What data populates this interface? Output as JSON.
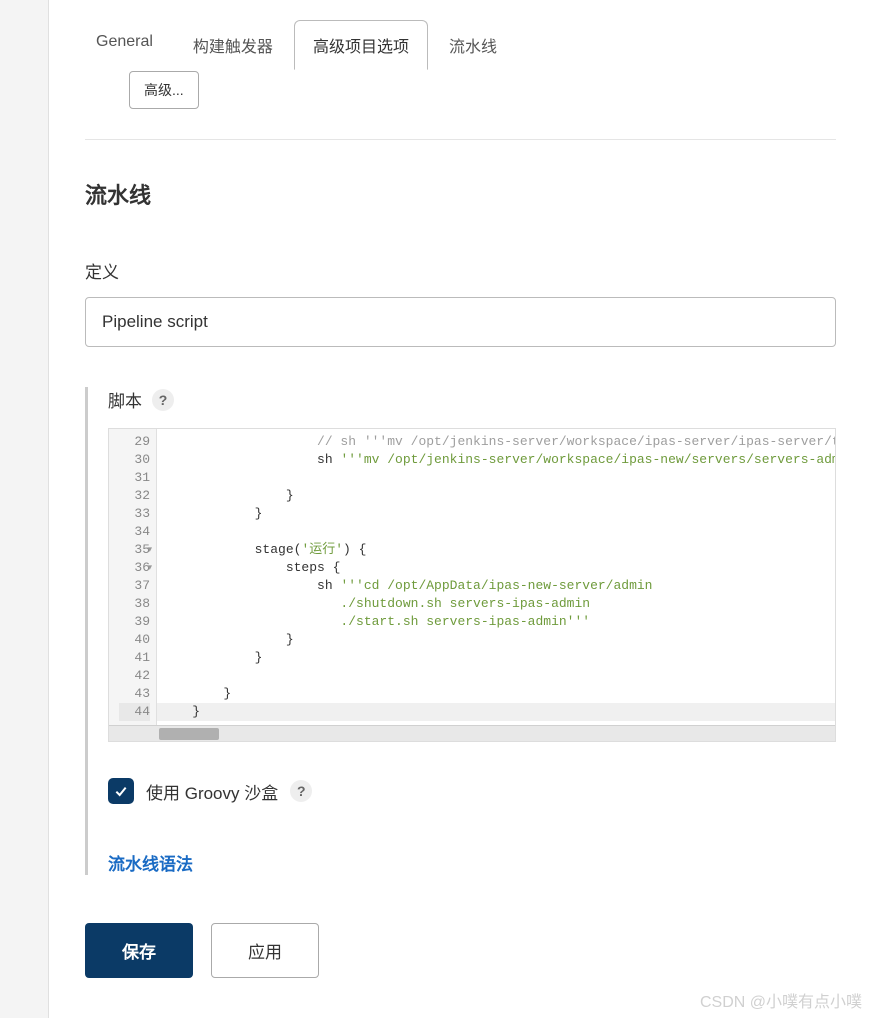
{
  "tabs": {
    "general": "General",
    "triggers": "构建触发器",
    "advanced": "高级项目选项",
    "pipeline": "流水线"
  },
  "advanced_button": "高级...",
  "section_title": "流水线",
  "definition_label": "定义",
  "definition_value": "Pipeline script",
  "script": {
    "label": "脚本",
    "lines": [
      {
        "n": 29,
        "fold": false,
        "segments": [
          {
            "cls": "tok-comment",
            "txt": "                    // sh '''mv /opt/jenkins-server/workspace/ipas-server/ipas-server/tar"
          }
        ]
      },
      {
        "n": 30,
        "fold": false,
        "segments": [
          {
            "cls": "tok-plain",
            "txt": "                    sh "
          },
          {
            "cls": "tok-str",
            "txt": "'''mv /opt/jenkins-server/workspace/ipas-new/servers/servers-admin"
          }
        ]
      },
      {
        "n": 31,
        "fold": false,
        "segments": [
          {
            "cls": "tok-plain",
            "txt": ""
          }
        ]
      },
      {
        "n": 32,
        "fold": false,
        "segments": [
          {
            "cls": "tok-plain",
            "txt": "                }"
          }
        ]
      },
      {
        "n": 33,
        "fold": false,
        "segments": [
          {
            "cls": "tok-plain",
            "txt": "            }"
          }
        ]
      },
      {
        "n": 34,
        "fold": false,
        "segments": [
          {
            "cls": "tok-plain",
            "txt": ""
          }
        ]
      },
      {
        "n": 35,
        "fold": true,
        "segments": [
          {
            "cls": "tok-plain",
            "txt": "            stage("
          },
          {
            "cls": "tok-str",
            "txt": "'运行'"
          },
          {
            "cls": "tok-plain",
            "txt": ") {"
          }
        ]
      },
      {
        "n": 36,
        "fold": true,
        "segments": [
          {
            "cls": "tok-plain",
            "txt": "                steps {"
          }
        ]
      },
      {
        "n": 37,
        "fold": false,
        "segments": [
          {
            "cls": "tok-plain",
            "txt": "                    sh "
          },
          {
            "cls": "tok-str",
            "txt": "'''cd /opt/AppData/ipas-new-server/admin"
          }
        ]
      },
      {
        "n": 38,
        "fold": false,
        "segments": [
          {
            "cls": "tok-str",
            "txt": "                       ./shutdown.sh servers-ipas-admin"
          }
        ]
      },
      {
        "n": 39,
        "fold": false,
        "segments": [
          {
            "cls": "tok-str",
            "txt": "                       ./start.sh servers-ipas-admin'''"
          }
        ]
      },
      {
        "n": 40,
        "fold": false,
        "segments": [
          {
            "cls": "tok-plain",
            "txt": "                }"
          }
        ]
      },
      {
        "n": 41,
        "fold": false,
        "segments": [
          {
            "cls": "tok-plain",
            "txt": "            }"
          }
        ]
      },
      {
        "n": 42,
        "fold": false,
        "segments": [
          {
            "cls": "tok-plain",
            "txt": ""
          }
        ]
      },
      {
        "n": 43,
        "fold": false,
        "segments": [
          {
            "cls": "tok-plain",
            "txt": "        }"
          }
        ]
      },
      {
        "n": 44,
        "fold": false,
        "current": true,
        "segments": [
          {
            "cls": "tok-plain",
            "txt": "    }"
          }
        ]
      }
    ]
  },
  "sandbox": {
    "checked": true,
    "label": "使用 Groovy 沙盒"
  },
  "pipeline_syntax_link": "流水线语法",
  "buttons": {
    "save": "保存",
    "apply": "应用"
  },
  "help_glyph": "?",
  "watermark": "CSDN @小噗有点小噗"
}
